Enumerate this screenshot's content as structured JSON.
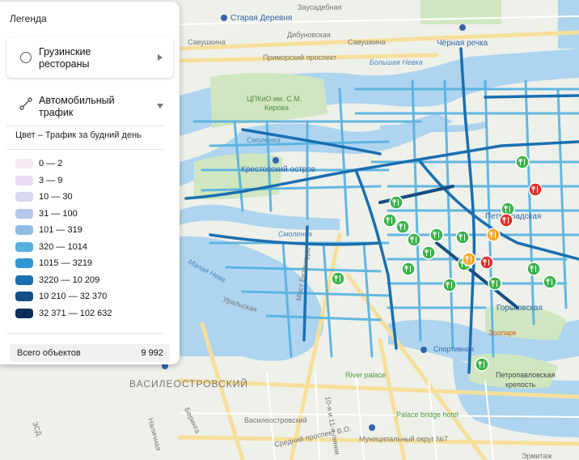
{
  "legend": {
    "title": "Легенда",
    "layers": [
      {
        "label": "Грузинские рестораны",
        "expanded": false,
        "icon": "radio-empty-icon"
      },
      {
        "label": "Автомобильный трафик",
        "expanded": true,
        "icon": "route-icon"
      }
    ],
    "color_title": "Цвет – Трафик за будний день",
    "ranges": [
      {
        "label": "0 — 2",
        "color": "#f5e9f4"
      },
      {
        "label": "3 — 9",
        "color": "#eadcf3"
      },
      {
        "label": "10 — 30",
        "color": "#d9d9f4"
      },
      {
        "label": "31 — 100",
        "color": "#b5c7ec"
      },
      {
        "label": "101 — 319",
        "color": "#8fbde6"
      },
      {
        "label": "320 — 1014",
        "color": "#54b1e0"
      },
      {
        "label": "1015 — 3219",
        "color": "#2f97d3"
      },
      {
        "label": "3220 — 10 209",
        "color": "#1a6fb0"
      },
      {
        "label": "10 210 — 32 370",
        "color": "#134e84"
      },
      {
        "label": "32 371 — 102 632",
        "color": "#0c2e58"
      }
    ],
    "total_label": "Всего объектов",
    "total_value": "9 992"
  },
  "map": {
    "colors": {
      "water": "#aed4ef",
      "land": "#eef0ea",
      "park": "#cfe6c0",
      "major_road": "#f6df9c"
    },
    "place_labels": [
      {
        "text": "Старая Деревня",
        "kind": "metro"
      },
      {
        "text": "Заусадебная",
        "kind": "street"
      },
      {
        "text": "Дибуновская",
        "kind": "street"
      },
      {
        "text": "Савушкина",
        "kind": "street"
      },
      {
        "text": "Савушкина",
        "kind": "street"
      },
      {
        "text": "Чёрная речка",
        "kind": "metro"
      },
      {
        "text": "Приморский проспект",
        "kind": "street"
      },
      {
        "text": "Большая Невка",
        "kind": "water"
      },
      {
        "text": "ЦПКиО им. С.М.",
        "kind": "park"
      },
      {
        "text": "Кирова",
        "kind": "park"
      },
      {
        "text": "Крестовский остров",
        "kind": "metro"
      },
      {
        "text": "Смоленка",
        "kind": "water"
      },
      {
        "text": "Смоленка",
        "kind": "water"
      },
      {
        "text": "Малая Нева",
        "kind": "water"
      },
      {
        "text": "Уральская",
        "kind": "street"
      },
      {
        "text": "Петроградская",
        "kind": "metro"
      },
      {
        "text": "Горьковская",
        "kind": "metro"
      },
      {
        "text": "Зоопарк",
        "kind": "poi"
      },
      {
        "text": "Спортивная",
        "kind": "metro"
      },
      {
        "text": "River palace",
        "kind": "poi"
      },
      {
        "text": "Петропавловская",
        "kind": "poi"
      },
      {
        "text": "крепость",
        "kind": "poi"
      },
      {
        "text": "ВАСИЛЕОСТРОВСКИЙ",
        "kind": "district"
      },
      {
        "text": "Василеостровский",
        "kind": "street"
      },
      {
        "text": "Palace bridge hotel",
        "kind": "poi"
      },
      {
        "text": "Муниципальный округ №7",
        "kind": "district"
      },
      {
        "text": "Эрмитаж",
        "kind": "poi"
      },
      {
        "text": "Беринга",
        "kind": "street"
      },
      {
        "text": "Наличная",
        "kind": "street"
      },
      {
        "text": "ЗСД",
        "kind": "street"
      },
      {
        "text": "Средний проспект В.О.",
        "kind": "street"
      },
      {
        "text": "10-я и 11-я линии",
        "kind": "street"
      },
      {
        "text": "Мост Бетанкура",
        "kind": "street"
      }
    ],
    "markers": [
      {
        "category": "restaurant",
        "color": "#3cb34a"
      },
      {
        "category": "restaurant",
        "color": "#3cb34a"
      },
      {
        "category": "restaurant",
        "color": "#3cb34a"
      },
      {
        "category": "restaurant",
        "color": "#3cb34a"
      },
      {
        "category": "restaurant",
        "color": "#3cb34a"
      },
      {
        "category": "restaurant",
        "color": "#3cb34a"
      },
      {
        "category": "restaurant",
        "color": "#3cb34a"
      },
      {
        "category": "restaurant",
        "color": "#3cb34a"
      },
      {
        "category": "restaurant",
        "color": "#3cb34a"
      },
      {
        "category": "restaurant",
        "color": "#3cb34a"
      },
      {
        "category": "restaurant",
        "color": "#3cb34a"
      },
      {
        "category": "restaurant",
        "color": "#3cb34a"
      },
      {
        "category": "restaurant",
        "color": "#3cb34a"
      },
      {
        "category": "restaurant",
        "color": "#3cb34a"
      },
      {
        "category": "restaurant",
        "color": "#3cb34a"
      },
      {
        "category": "restaurant",
        "color": "#3cb34a"
      },
      {
        "category": "restaurant",
        "color": "#3cb34a"
      },
      {
        "category": "restaurant",
        "color": "#e0322a"
      },
      {
        "category": "restaurant",
        "color": "#e0322a"
      },
      {
        "category": "restaurant",
        "color": "#e0322a"
      },
      {
        "category": "restaurant",
        "color": "#f0a830"
      },
      {
        "category": "restaurant",
        "color": "#f0a830"
      }
    ]
  }
}
